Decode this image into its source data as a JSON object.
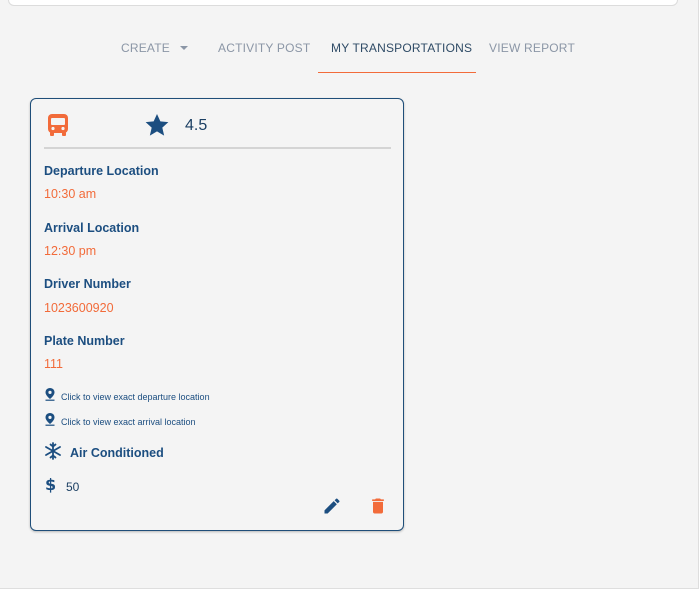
{
  "colors": {
    "accent": "#f26b3a",
    "primary": "#1c4e80",
    "tab_inactive": "#8b96a6",
    "background": "#f4f4f4"
  },
  "tabs": [
    {
      "label": "CREATE",
      "has_dropdown": true,
      "active": false
    },
    {
      "label": "ACTIVITY POST",
      "active": false
    },
    {
      "label": "MY TRANSPORTATIONS",
      "active": true
    },
    {
      "label": "VIEW REPORT",
      "active": false
    }
  ],
  "card": {
    "vehicle_icon": "bus-icon",
    "rating_icon": "star-icon",
    "rating": "4.5",
    "fields": [
      {
        "label": "Departure Location",
        "value": "10:30 am"
      },
      {
        "label": "Arrival Location",
        "value": "12:30 pm"
      },
      {
        "label": "Driver Number",
        "value": "1023600920"
      },
      {
        "label": "Plate Number",
        "value": "111"
      }
    ],
    "links": [
      {
        "icon": "map-pin-icon",
        "text": "Click to view exact departure location"
      },
      {
        "icon": "map-pin-icon",
        "text": "Click to view exact arrival location"
      }
    ],
    "feature": {
      "icon": "snowflake-icon",
      "label": "Air Conditioned"
    },
    "price": {
      "icon": "dollar-icon",
      "value": "50"
    },
    "actions": {
      "edit_icon": "pencil-icon",
      "delete_icon": "trash-icon"
    }
  }
}
